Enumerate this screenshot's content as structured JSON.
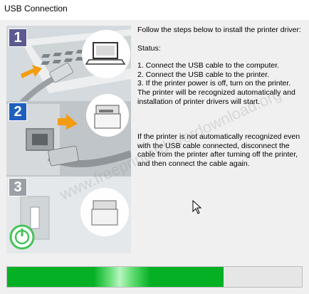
{
  "window": {
    "title": "USB Connection"
  },
  "steps": [
    {
      "number": "1"
    },
    {
      "number": "2"
    },
    {
      "number": "3"
    }
  ],
  "instructions": {
    "intro": "Follow the steps below to install the printer driver:",
    "status_label": "Status:",
    "step1": "1. Connect the USB cable to the computer.",
    "step2": "2. Connect the USB cable to the printer.",
    "step3": "3. If the printer power is off, turn on the printer.",
    "recognition": "The printer will be recognized automatically and installation of printer drivers will start.",
    "fallback": "If the printer is not automatically recognized even with the USB cable connected, disconnect the cable from the printer after turning off the printer, and then connect the cable again."
  },
  "watermark": "www.freeprinterdriverdownload.org",
  "progress": {
    "fraction": 0.735
  },
  "colors": {
    "step_badge": "#5b5b8f",
    "step_badge_active": "#1f5fbf",
    "progress_green": "#06b025",
    "arrow_orange": "#f39c12",
    "power_green": "#46c35a"
  }
}
